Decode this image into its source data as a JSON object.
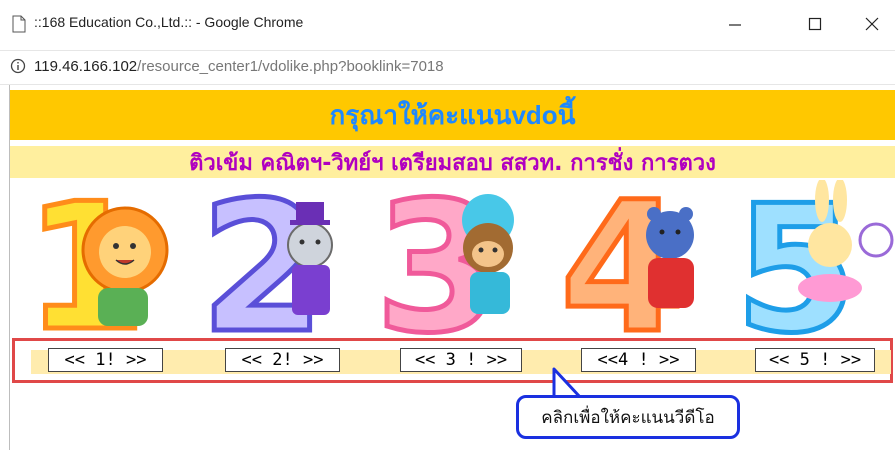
{
  "window": {
    "title": "::168 Education Co.,Ltd.:: - Google Chrome",
    "minimize": "—",
    "maximize": "☐",
    "close": "✕"
  },
  "address": {
    "host": "119.46.166.102",
    "path": "/resource_center1/vdolike.php?booklink=7018"
  },
  "page": {
    "heading_thai": "กรุณาให้คะแนน",
    "heading_vdo": "vdo",
    "heading_suffix": " นี้",
    "subtitle": "ติวเข้ม คณิตฯ-วิทย์ฯ เตรียมสอบ สสวท. การชั่ง การตวง",
    "numbers": [
      "1",
      "2",
      "3",
      "4",
      "5"
    ]
  },
  "buttons": [
    {
      "label": "<< 1! >>"
    },
    {
      "label": "<< 2! >>"
    },
    {
      "label": "<< 3 ! >>"
    },
    {
      "label": "<<4 ! >>"
    },
    {
      "label": "<< 5 ! >>"
    }
  ],
  "callout": {
    "text": "คลิกเพื่อให้คะแนนวีดีโอ"
  },
  "colors": {
    "header_bg": "#ffc800",
    "header_text": "#1e88ff",
    "subtitle_bg": "#ffef9e",
    "subtitle_text": "#b000c0",
    "highlight_border": "#e04848",
    "callout_border": "#1a30e0"
  }
}
